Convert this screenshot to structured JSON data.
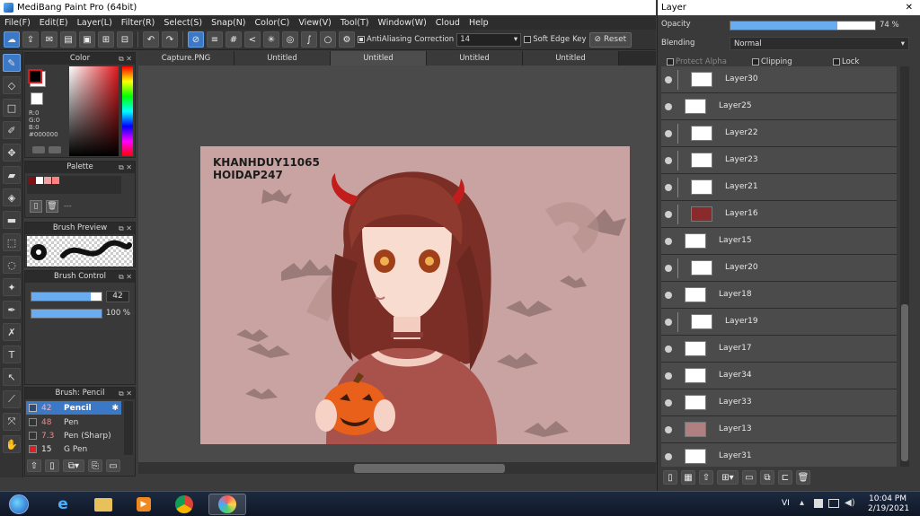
{
  "window": {
    "title": "MediBang Paint Pro (64bit)"
  },
  "menu": [
    "File(F)",
    "Edit(E)",
    "Layer(L)",
    "Filter(R)",
    "Select(S)",
    "Snap(N)",
    "Color(C)",
    "View(V)",
    "Tool(T)",
    "Window(W)",
    "Cloud",
    "Help"
  ],
  "toolbar": {
    "antialiasing_label": "AntiAliasing",
    "correction_label": "Correction",
    "correction_value": "14",
    "soft_edge_label": "Soft Edge",
    "key_label": "Key",
    "reset_label": "Reset"
  },
  "color_panel": {
    "title": "Color",
    "r": "R:0",
    "g": "G:0",
    "b": "B:0",
    "hex": "#000000",
    "fg": "#000000",
    "bg": "#ffffff",
    "accent": "#e0181c"
  },
  "palette_panel": {
    "title": "Palette",
    "colors": [
      "#7a1216",
      "#ffffff",
      "#f0a0a0",
      "#ff8080"
    ],
    "label": "---"
  },
  "brush_preview": {
    "title": "Brush Preview"
  },
  "brush_control": {
    "title": "Brush Control",
    "size_value": "42",
    "opacity_value": "100 %",
    "size_fraction": 0.84,
    "opacity_fraction": 1.0
  },
  "brush_list": {
    "title": "Brush: Pencil",
    "items": [
      {
        "size": "42",
        "name": "Pencil",
        "color": "#2a4d7a"
      },
      {
        "size": "48",
        "name": "Pen",
        "color": "#333333"
      },
      {
        "size": "7.3",
        "name": "Pen (Sharp)",
        "color": "#333333"
      },
      {
        "size": "15",
        "name": "G Pen",
        "color": "#e02020"
      }
    ]
  },
  "tabs": [
    "Capture.PNG",
    "Untitled",
    "Untitled",
    "Untitled",
    "Untitled"
  ],
  "artwork": {
    "watermark_line1": "KHANHDUY11065",
    "watermark_line2": "HOIDAP247"
  },
  "layer_panel": {
    "title": "Layer",
    "opacity_label": "Opacity",
    "opacity_value": "74 %",
    "opacity_fraction": 0.74,
    "blending_label": "Blending",
    "blending_value": "Normal",
    "protect_alpha_label": "Protect Alpha",
    "clipping_label": "Clipping",
    "lock_label": "Lock",
    "layers": [
      {
        "name": "Layer30",
        "indent": true,
        "thumb": "checker"
      },
      {
        "name": "Layer25",
        "indent": false,
        "thumb": "checker"
      },
      {
        "name": "Layer22",
        "indent": true,
        "thumb": "checker"
      },
      {
        "name": "Layer23",
        "indent": true,
        "thumb": "checker"
      },
      {
        "name": "Layer21",
        "indent": true,
        "thumb": "checker"
      },
      {
        "name": "Layer16",
        "indent": true,
        "thumb": "#8a2a2a"
      },
      {
        "name": "Layer15",
        "indent": false,
        "thumb": "checker"
      },
      {
        "name": "Layer20",
        "indent": true,
        "thumb": "checker"
      },
      {
        "name": "Layer18",
        "indent": false,
        "thumb": "checker"
      },
      {
        "name": "Layer19",
        "indent": true,
        "thumb": "checker"
      },
      {
        "name": "Layer17",
        "indent": false,
        "thumb": "checker"
      },
      {
        "name": "Layer34",
        "indent": false,
        "thumb": "checker"
      },
      {
        "name": "Layer33",
        "indent": false,
        "thumb": "checker"
      },
      {
        "name": "Layer13",
        "indent": false,
        "thumb": "#b08080"
      },
      {
        "name": "Layer31",
        "indent": false,
        "thumb": "#ffffff"
      }
    ]
  },
  "taskbar": {
    "lang": "VI",
    "time": "10:04 PM",
    "date": "2/19/2021"
  }
}
